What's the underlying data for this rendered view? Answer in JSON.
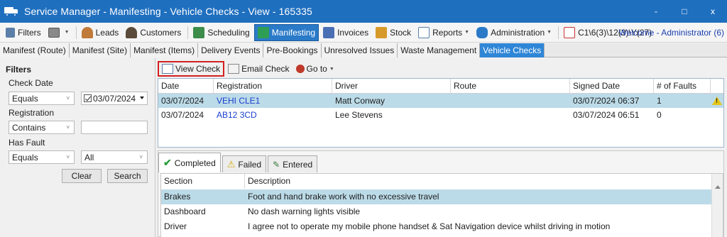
{
  "window": {
    "title": "Service Manager - Manifesting - Vehicle Checks - View - 165335",
    "minimize": "-",
    "maximize": "□",
    "close": "x"
  },
  "menu": {
    "filters": "Filters",
    "leads": "Leads",
    "customers": "Customers",
    "scheduling": "Scheduling",
    "manifesting": "Manifesting",
    "invoices": "Invoices",
    "stock": "Stock",
    "reports": "Reports",
    "administration": "Administration",
    "path": "C1\\6(3)\\12(3)\\Y(27)",
    "welcome": "Welcome - Administrator (6)"
  },
  "tabs": [
    "Manifest (Route)",
    "Manifest (Site)",
    "Manifest (Items)",
    "Delivery Events",
    "Pre-Bookings",
    "Unresolved Issues",
    "Waste Management",
    "Vehicle Checks"
  ],
  "filters": {
    "header": "Filters",
    "check_date_label": "Check Date",
    "check_date_op": "Equals",
    "check_date_value": "03/07/2024",
    "registration_label": "Registration",
    "registration_op": "Contains",
    "registration_value": "",
    "fault_label": "Has Fault",
    "fault_op": "Equals",
    "fault_value": "All",
    "clear": "Clear",
    "search": "Search"
  },
  "toolbar": {
    "view_check": "View Check",
    "email_check": "Email Check",
    "go_to": "Go to"
  },
  "grid": {
    "columns": [
      "Date",
      "Registration",
      "Driver",
      "Route",
      "Signed Date",
      "# of Faults"
    ],
    "rows": [
      {
        "date": "03/07/2024",
        "registration": "VEHI CLE1",
        "driver": "Matt Conway",
        "route": "",
        "signed": "03/07/2024 06:37",
        "faults": "1",
        "warn": true
      },
      {
        "date": "03/07/2024",
        "registration": "AB12 3CD",
        "driver": "Lee Stevens",
        "route": "",
        "signed": "03/07/2024 06:51",
        "faults": "0",
        "warn": false
      }
    ]
  },
  "lower_tabs": {
    "completed": "Completed",
    "failed": "Failed",
    "entered": "Entered"
  },
  "lower_grid": {
    "columns": [
      "Section",
      "Description"
    ],
    "rows": [
      {
        "section": "Brakes",
        "description": "Foot and hand brake work with no excessive travel"
      },
      {
        "section": "Dashboard",
        "description": "No dash warning lights visible"
      },
      {
        "section": "Driver",
        "description": "I agree not to operate my mobile phone handset & Sat Navigation device whilst driving in motion"
      }
    ]
  },
  "colors": {
    "titlebar": "#1f6fbf",
    "active_tab": "#2f86d6",
    "selection": "#bcdbe8",
    "link": "#1a3fd0"
  }
}
